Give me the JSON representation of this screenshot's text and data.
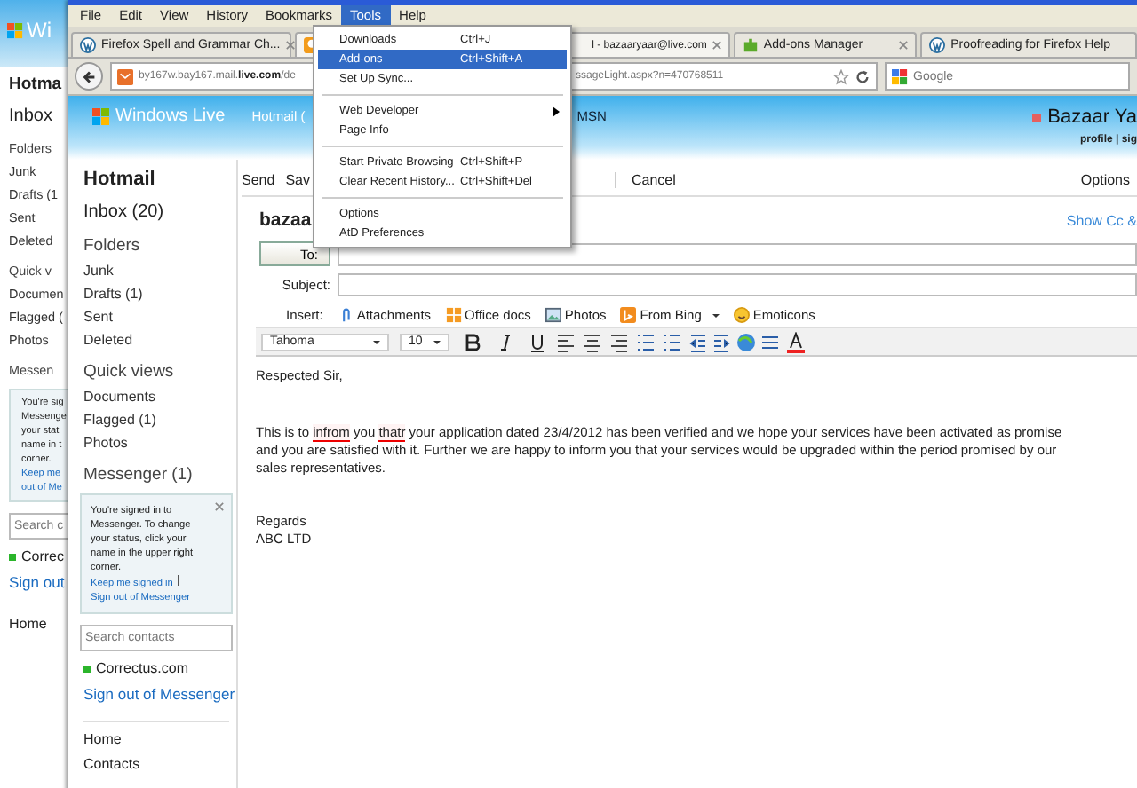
{
  "back_window": {
    "logo_text": "Wi",
    "title": "Hotma",
    "inbox": "Inbox",
    "folders_heading": "Folders",
    "folders": [
      "Junk",
      "Drafts (1",
      "Sent",
      "Deleted"
    ],
    "quick_views_heading": "Quick v",
    "quick_views": [
      "Documen",
      "Flagged (",
      "Photos"
    ],
    "messenger_heading": "Messen",
    "messenger_lines": [
      "You're sig",
      "Messenge",
      "your stat",
      "name in t",
      "corner."
    ],
    "messenger_links": [
      "Keep me",
      "out of Me"
    ],
    "search_placeholder": "Search c",
    "contact": "Correc",
    "sign_out": "Sign out",
    "nav": [
      "Home"
    ]
  },
  "menu_bar": [
    {
      "label": "File",
      "selected": false
    },
    {
      "label": "Edit",
      "selected": false
    },
    {
      "label": "View",
      "selected": false
    },
    {
      "label": "History",
      "selected": false
    },
    {
      "label": "Bookmarks",
      "selected": false
    },
    {
      "label": "Tools",
      "selected": true
    },
    {
      "label": "Help",
      "selected": false
    }
  ],
  "tabs": [
    {
      "label": "Firefox Spell and Grammar Ch...",
      "selected": false
    },
    {
      "label": "l - bazaaryaar@live.com",
      "selected": true
    },
    {
      "label": "Add-ons Manager",
      "selected": false
    },
    {
      "label": "Proofreading for Firefox Help",
      "selected": false
    }
  ],
  "address_bar": {
    "left": "by167w.bay167.mail.**live.com**/de",
    "right": "ssageLight.aspx?n=470768511"
  },
  "search": {
    "placeholder": "Google"
  },
  "tools_menu": [
    {
      "kind": "item",
      "label": "Downloads",
      "shortcut": "Ctrl+J",
      "selected": false
    },
    {
      "kind": "item",
      "label": "Add-ons",
      "shortcut": "Ctrl+Shift+A",
      "selected": true
    },
    {
      "kind": "item",
      "label": "Set Up Sync...",
      "selected": false
    },
    {
      "kind": "separator"
    },
    {
      "kind": "submenu",
      "label": "Web Developer",
      "selected": false
    },
    {
      "kind": "item",
      "label": "Page Info",
      "selected": false
    },
    {
      "kind": "separator"
    },
    {
      "kind": "item",
      "label": "Start Private Browsing",
      "shortcut": "Ctrl+Shift+P",
      "selected": false
    },
    {
      "kind": "item",
      "label": "Clear Recent History...",
      "shortcut": "Ctrl+Shift+Del",
      "selected": false
    },
    {
      "kind": "separator"
    },
    {
      "kind": "item",
      "label": "Options",
      "selected": false
    },
    {
      "kind": "item",
      "label": "AtD Preferences",
      "selected": false
    }
  ],
  "header": {
    "logo_text": "Windows Live",
    "nav": [
      "Hotmail (",
      "MSN"
    ],
    "user": "Bazaar Ya",
    "user_links": "profile | sig"
  },
  "sidebar": {
    "title": "Hotmail",
    "inbox": "Inbox (20)",
    "folders_heading": "Folders",
    "folders": [
      "Junk",
      "Drafts (1)",
      "Sent",
      "Deleted"
    ],
    "quick_views_heading": "Quick views",
    "quick_views": [
      "Documents",
      "Flagged (1)",
      "Photos"
    ],
    "messenger_heading": "Messenger (1)",
    "messenger_text": "You're signed in to Messenger. To change your status, click your name in the upper right corner.",
    "messenger_links": [
      "Keep me signed in",
      "Sign out of Messenger"
    ],
    "search_placeholder": "Search contacts",
    "contact": "Correctus.com",
    "sign_out": "Sign out of Messenger",
    "nav": [
      "Home",
      "Contacts"
    ]
  },
  "toolbar": {
    "left": [
      "Send",
      "Sav"
    ],
    "right": [
      "Cancel"
    ],
    "options": "Options"
  },
  "compose": {
    "heading": "bazaa",
    "show_cc": "Show Cc &",
    "to_label": "To:",
    "subject_label": "Subject:",
    "insert_label": "Insert:",
    "insert_items": [
      {
        "label": "Attachments",
        "dropdown": false
      },
      {
        "label": "Office docs",
        "dropdown": false
      },
      {
        "label": "Photos",
        "dropdown": false
      },
      {
        "label": "From Bing",
        "dropdown": true
      },
      {
        "label": "Emoticons",
        "dropdown": false
      }
    ],
    "font": "Tahoma",
    "size": "10",
    "body": [
      {
        "kind": "line",
        "text": "Respected Sir,"
      },
      {
        "kind": "paragraph",
        "lines": [
          [
            {
              "text": "This is to "
            },
            {
              "text": "infrom",
              "misspelled": true
            },
            {
              "text": " you "
            },
            {
              "text": "thatr",
              "misspelled": true
            },
            {
              "text": " your application dated 23/4/2012 has been verified and we hope your services have been activated as promise"
            }
          ],
          [
            {
              "text": "and you are satisfied with it. Further we are happy to inform you that your services would be upgraded within the period promised by our"
            }
          ],
          [
            {
              "text": "sales representatives."
            }
          ]
        ]
      },
      {
        "kind": "line",
        "text": "Regards"
      },
      {
        "kind": "line",
        "text": "ABC LTD"
      }
    ]
  }
}
